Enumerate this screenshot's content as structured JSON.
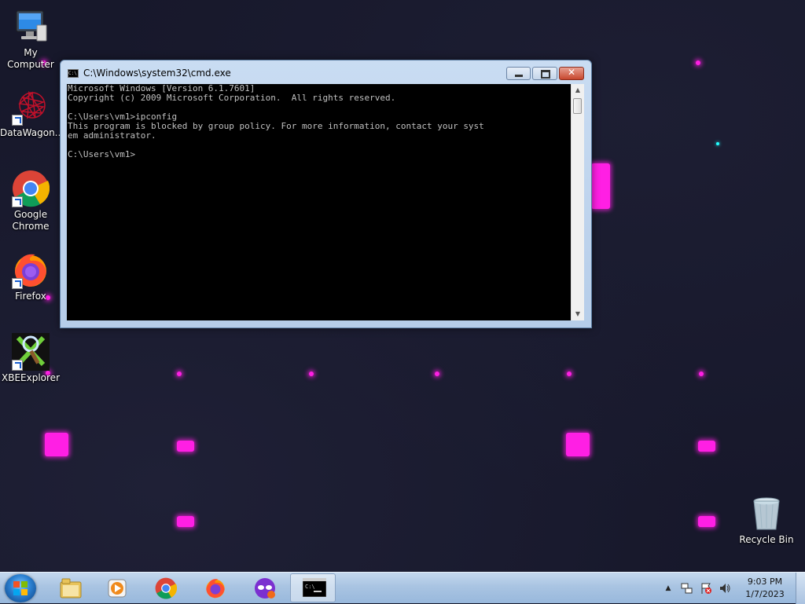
{
  "desktop": {
    "icons": [
      {
        "label": "My Computer",
        "icon": "computer-icon"
      },
      {
        "label": "DataWagon...",
        "icon": "datawagon-icon"
      },
      {
        "label": "Google Chrome",
        "icon": "chrome-icon"
      },
      {
        "label": "Firefox",
        "icon": "firefox-icon"
      },
      {
        "label": "XBEExplorer",
        "icon": "xbeexplorer-icon"
      },
      {
        "label": "Recycle Bin",
        "icon": "recycle-bin-icon"
      }
    ],
    "accent_color": "#ff1fe4"
  },
  "cmd": {
    "title": "C:\\Windows\\system32\\cmd.exe",
    "icon_text": "C:\\",
    "close_glyph": "✕",
    "lines": [
      "Microsoft Windows [Version 6.1.7601]",
      "Copyright (c) 2009 Microsoft Corporation.  All rights reserved.",
      "",
      "C:\\Users\\vm1>ipconfig",
      "This program is blocked by group policy. For more information, contact your syst",
      "em administrator.",
      "",
      "C:\\Users\\vm1>"
    ],
    "text_color": "#c0c0c0",
    "background_color": "#000000"
  },
  "taskbar": {
    "items": [
      {
        "name": "windows-explorer",
        "icon": "folder-icon"
      },
      {
        "name": "media-player",
        "icon": "media-player-icon"
      },
      {
        "name": "google-chrome",
        "icon": "chrome-icon"
      },
      {
        "name": "firefox",
        "icon": "firefox-icon"
      },
      {
        "name": "mask-app",
        "icon": "mask-icon"
      },
      {
        "name": "command-prompt",
        "icon": "cmd-icon",
        "active": true
      }
    ],
    "clock": {
      "time": "9:03 PM",
      "date": "1/7/2023"
    }
  }
}
